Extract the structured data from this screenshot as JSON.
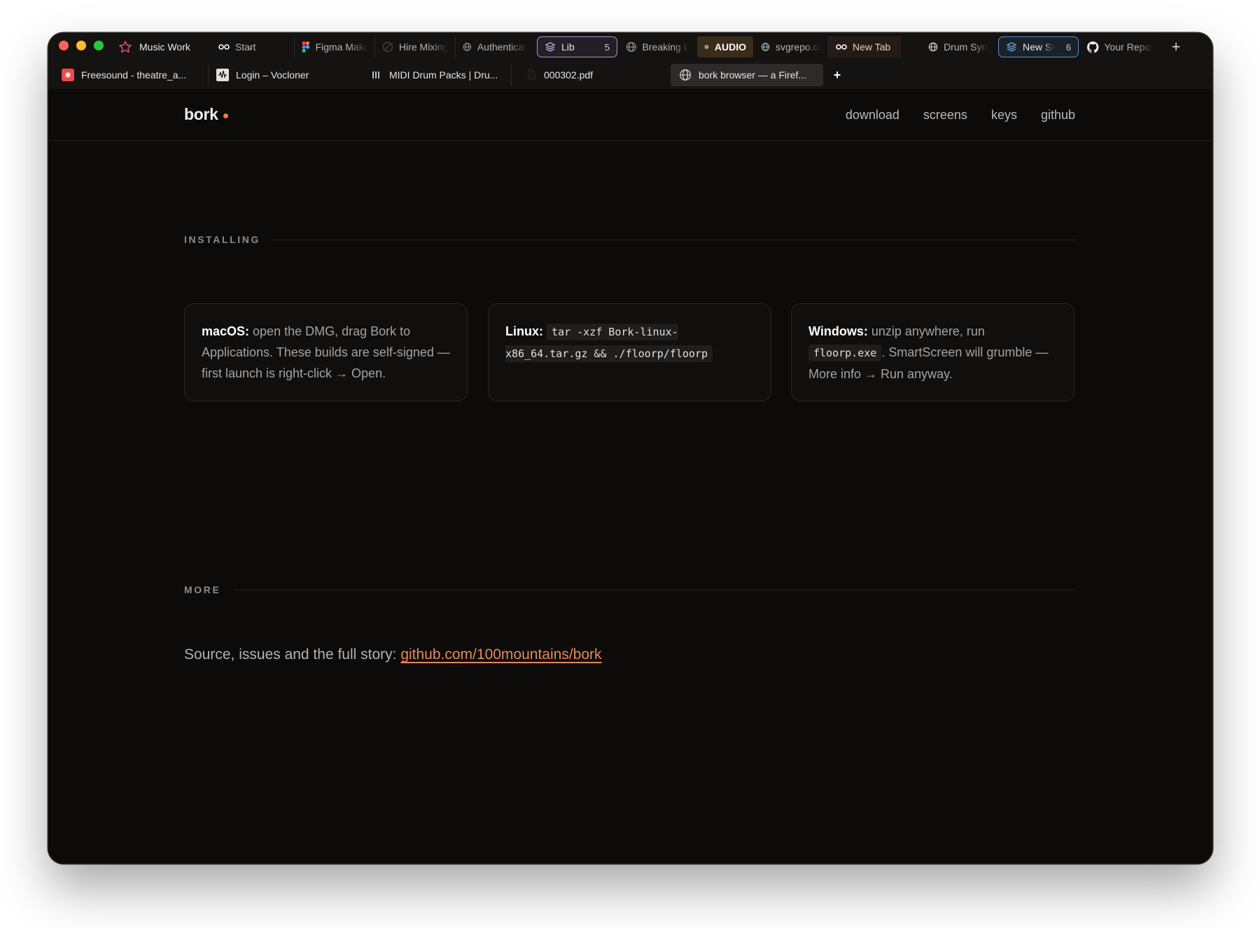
{
  "browser": {
    "workspace": {
      "name": "Music Work"
    },
    "tabs_row1": [
      {
        "label": "Start"
      },
      {
        "label": "Figma Make"
      },
      {
        "label": "Hire Mixing"
      },
      {
        "label": "Authentication"
      },
      {
        "label": "Lib",
        "count": "5"
      },
      {
        "label": "Breaking B"
      },
      {
        "label": "AUDIO"
      },
      {
        "label": "svgrepo.com"
      },
      {
        "label": "New Tab"
      },
      {
        "label": "Drum Synth"
      },
      {
        "label": "New St",
        "count": "6"
      },
      {
        "label": "Your Repos"
      }
    ],
    "tabs_row2": [
      {
        "label": "Freesound - theatre_a..."
      },
      {
        "label": "Login – Vocloner"
      },
      {
        "label": "MIDI Drum Packs | Dru..."
      },
      {
        "label": "000302.pdf"
      },
      {
        "label": "bork browser — a Firef..."
      }
    ]
  },
  "site": {
    "brand": "bork",
    "nav": [
      "download",
      "screens",
      "keys",
      "github"
    ],
    "installing": {
      "heading": "INSTALLING",
      "cards": [
        {
          "os": "macOS:",
          "text": " open the DMG, drag Bork to Applications. These builds are self-signed — first launch is right-click → Open."
        },
        {
          "os": "Linux:",
          "code": "tar -xzf Bork-linux-x86_64.tar.gz && ./floorp/floorp"
        },
        {
          "os": "Windows:",
          "text_before": " unzip anywhere, run ",
          "code": "floorp.exe",
          "text_after": ". SmartScreen will grumble — More info → Run anyway."
        }
      ]
    },
    "more": {
      "heading": "MORE",
      "text": "Source, issues and the full story: ",
      "link": "github.com/100mountains/bork"
    }
  },
  "colors": {
    "accent": "#e8875b",
    "background": "#0c0b0a",
    "lib_tab_border": "#b98fd6",
    "newst_tab_border": "#5b90d0"
  }
}
